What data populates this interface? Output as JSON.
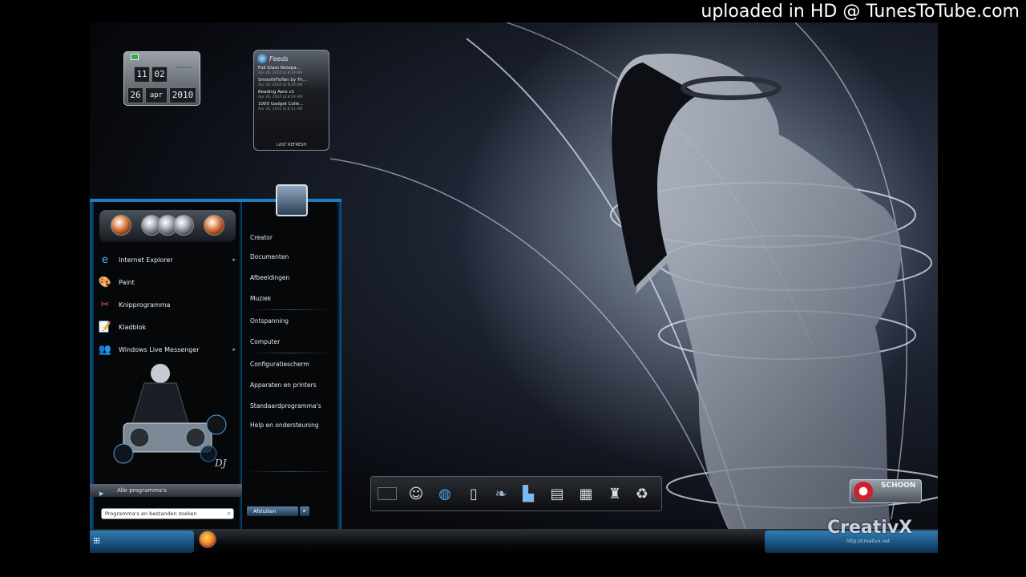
{
  "watermark": "uploaded in HD @ TunesToTube.com",
  "clock_gadget": {
    "hour": "11",
    "minute": "02",
    "day": "26",
    "month": "apr",
    "year": "2010"
  },
  "feed_gadget": {
    "title": "Feeds",
    "items": [
      {
        "title": "Full Glass Notepa...",
        "date": "Apr 26, 2010 at 8:29 AM"
      },
      {
        "title": "SmoothFloTan by Th...",
        "date": "Apr 26, 2010 at 8:29 AM"
      },
      {
        "title": "Reading Aero v1",
        "date": "Apr 26, 2010 at 8:29 AM"
      },
      {
        "title": "1000 Gadget Colle...",
        "date": "Apr 26, 2010 at 8:11 AM"
      }
    ],
    "footer": "LAST REFRESH"
  },
  "start_menu": {
    "programs": [
      {
        "label": "Internet Explorer",
        "icon": "internet-explorer-icon",
        "has_submenu": true
      },
      {
        "label": "Paint",
        "icon": "paint-icon",
        "has_submenu": false
      },
      {
        "label": "Knipprogramma",
        "icon": "snipping-tool-icon",
        "has_submenu": false
      },
      {
        "label": "Kladblok",
        "icon": "notepad-icon",
        "has_submenu": false
      },
      {
        "label": "Windows Live Messenger",
        "icon": "messenger-icon",
        "has_submenu": true
      }
    ],
    "all_programs": "Alle programma's",
    "search_placeholder": "Programma's en bestanden zoeken",
    "places": [
      "Creator",
      "Documenten",
      "Afbeeldingen",
      "Muziek",
      "Ontspanning",
      "Computer",
      "Configuratiescherm",
      "Apparaten en printers",
      "Standaardprogramma's",
      "Help en ondersteuning"
    ],
    "shutdown_label": "Afsluiten",
    "dj_text": "DJ"
  },
  "dock": {
    "icons": [
      "monitor-icon",
      "smiley-icon",
      "globe-icon",
      "info-icon",
      "feather-icon",
      "city-icon",
      "scanner-icon",
      "printer-icon",
      "trash-icon",
      "recycle-icon"
    ]
  },
  "branding": {
    "name": "CreativX",
    "url": "http://creativx.net",
    "school": "SCHOON"
  }
}
